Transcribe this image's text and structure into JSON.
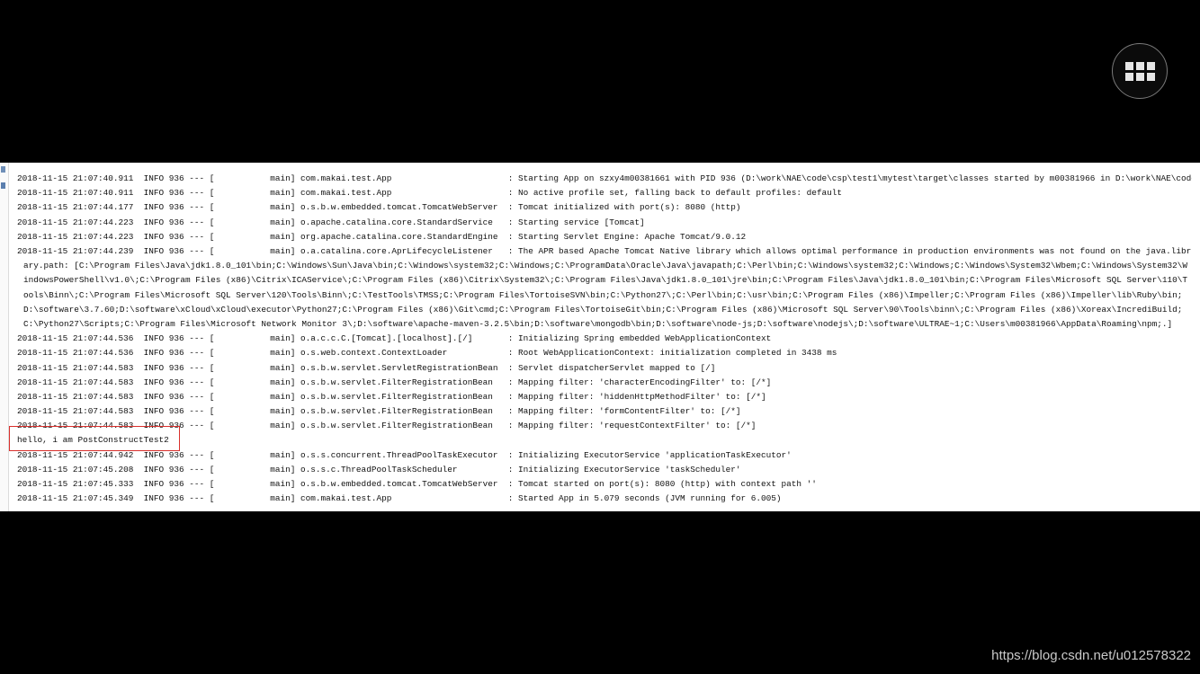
{
  "overlay": {
    "menu_icon": "grid-icon"
  },
  "log_lines": [
    {
      "text": "2018-11-15 21:07:40.911  INFO 936 --- [           main] com.makai.test.App                       : Starting App on szxy4m00381661 with PID 936 (D:\\work\\NAE\\code\\csp\\test1\\mytest\\target\\classes started by m00381966 in D:\\work\\NAE\\code\\csp\\test1)"
    },
    {
      "text": "2018-11-15 21:07:40.911  INFO 936 --- [           main] com.makai.test.App                       : No active profile set, falling back to default profiles: default"
    },
    {
      "text": "2018-11-15 21:07:44.177  INFO 936 --- [           main] o.s.b.w.embedded.tomcat.TomcatWebServer  : Tomcat initialized with port(s): 8080 (http)"
    },
    {
      "text": "2018-11-15 21:07:44.223  INFO 936 --- [           main] o.apache.catalina.core.StandardService   : Starting service [Tomcat]"
    },
    {
      "text": "2018-11-15 21:07:44.223  INFO 936 --- [           main] org.apache.catalina.core.StandardEngine  : Starting Servlet Engine: Apache Tomcat/9.0.12"
    },
    {
      "text": "2018-11-15 21:07:44.239  INFO 936 --- [           main] o.a.catalina.core.AprLifecycleListener   : The APR based Apache Tomcat Native library which allows optimal performance in production environments was not found on the java.library.path: [C:\\Program Files\\Java\\jdk1.8.0_101\\bin;C:\\Windows\\Sun\\Java\\bin;C:\\Windows\\system32;C:\\Windows;C:\\ProgramData\\Oracle\\Java\\javapath;C:\\Perl\\bin;C:\\Windows\\system32;C:\\Windows;C:\\Windows\\System32\\Wbem;C:\\Windows\\System32\\WindowsPowerShell\\v1.0\\;C:\\Program Files (x86)\\Citrix\\ICAService\\;C:\\Program Files (x86)\\Citrix\\System32\\;C:\\Program Files\\Java\\jdk1.8.0_101\\jre\\bin;C:\\Program Files\\Java\\jdk1.8.0_101\\bin;C:\\Program Files\\Microsoft SQL Server\\110\\Tools\\Binn\\;C:\\Program Files\\Microsoft SQL Server\\120\\Tools\\Binn\\;C:\\TestTools\\TMSS;C:\\Program Files\\TortoiseSVN\\bin;C:\\Python27\\;C:\\Perl\\bin;C:\\usr\\bin;C:\\Program Files (x86)\\Impeller;C:\\Program Files (x86)\\Impeller\\lib\\Ruby\\bin;D:\\software\\3.7.60;D:\\software\\xCloud\\xCloud\\executor\\Python27;C:\\Program Files (x86)\\Git\\cmd;C:\\Program Files\\TortoiseGit\\bin;C:\\Program Files (x86)\\Microsoft SQL Server\\90\\Tools\\binn\\;C:\\Program Files (x86)\\Xoreax\\IncrediBuild;C:\\Python27\\Scripts;C:\\Program Files\\Microsoft Network Monitor 3\\;D:\\software\\apache-maven-3.2.5\\bin;D:\\software\\mongodb\\bin;D:\\software\\node-js;D:\\software\\nodejs\\;D:\\software\\ULTRAE~1;C:\\Users\\m00381966\\AppData\\Roaming\\npm;.]",
      "wrap": true
    },
    {
      "text": "2018-11-15 21:07:44.536  INFO 936 --- [           main] o.a.c.c.C.[Tomcat].[localhost].[/]       : Initializing Spring embedded WebApplicationContext"
    },
    {
      "text": "2018-11-15 21:07:44.536  INFO 936 --- [           main] o.s.web.context.ContextLoader            : Root WebApplicationContext: initialization completed in 3438 ms"
    },
    {
      "text": "2018-11-15 21:07:44.583  INFO 936 --- [           main] o.s.b.w.servlet.ServletRegistrationBean  : Servlet dispatcherServlet mapped to [/]"
    },
    {
      "text": "2018-11-15 21:07:44.583  INFO 936 --- [           main] o.s.b.w.servlet.FilterRegistrationBean   : Mapping filter: 'characterEncodingFilter' to: [/*]"
    },
    {
      "text": "2018-11-15 21:07:44.583  INFO 936 --- [           main] o.s.b.w.servlet.FilterRegistrationBean   : Mapping filter: 'hiddenHttpMethodFilter' to: [/*]"
    },
    {
      "text": "2018-11-15 21:07:44.583  INFO 936 --- [           main] o.s.b.w.servlet.FilterRegistrationBean   : Mapping filter: 'formContentFilter' to: [/*]"
    },
    {
      "text": "2018-11-15 21:07:44.583  INFO 936 --- [           main] o.s.b.w.servlet.FilterRegistrationBean   : Mapping filter: 'requestContextFilter' to: [/*]"
    },
    {
      "text": "hello, i am PostConstructTest2"
    },
    {
      "text": "2018-11-15 21:07:44.942  INFO 936 --- [           main] o.s.s.concurrent.ThreadPoolTaskExecutor  : Initializing ExecutorService 'applicationTaskExecutor'"
    },
    {
      "text": "2018-11-15 21:07:45.208  INFO 936 --- [           main] o.s.s.c.ThreadPoolTaskScheduler          : Initializing ExecutorService 'taskScheduler'"
    },
    {
      "text": "2018-11-15 21:07:45.333  INFO 936 --- [           main] o.s.b.w.embedded.tomcat.TomcatWebServer  : Tomcat started on port(s): 8080 (http) with context path ''"
    },
    {
      "text": "2018-11-15 21:07:45.349  INFO 936 --- [           main] com.makai.test.App                       : Started App in 5.079 seconds (JVM running for 6.005)"
    }
  ],
  "watermark": "https://blog.csdn.net/u012578322",
  "colors": {
    "background": "#000000",
    "console_background": "#ffffff",
    "highlight_border": "#d9302c",
    "watermark": "#c9c9c9"
  }
}
